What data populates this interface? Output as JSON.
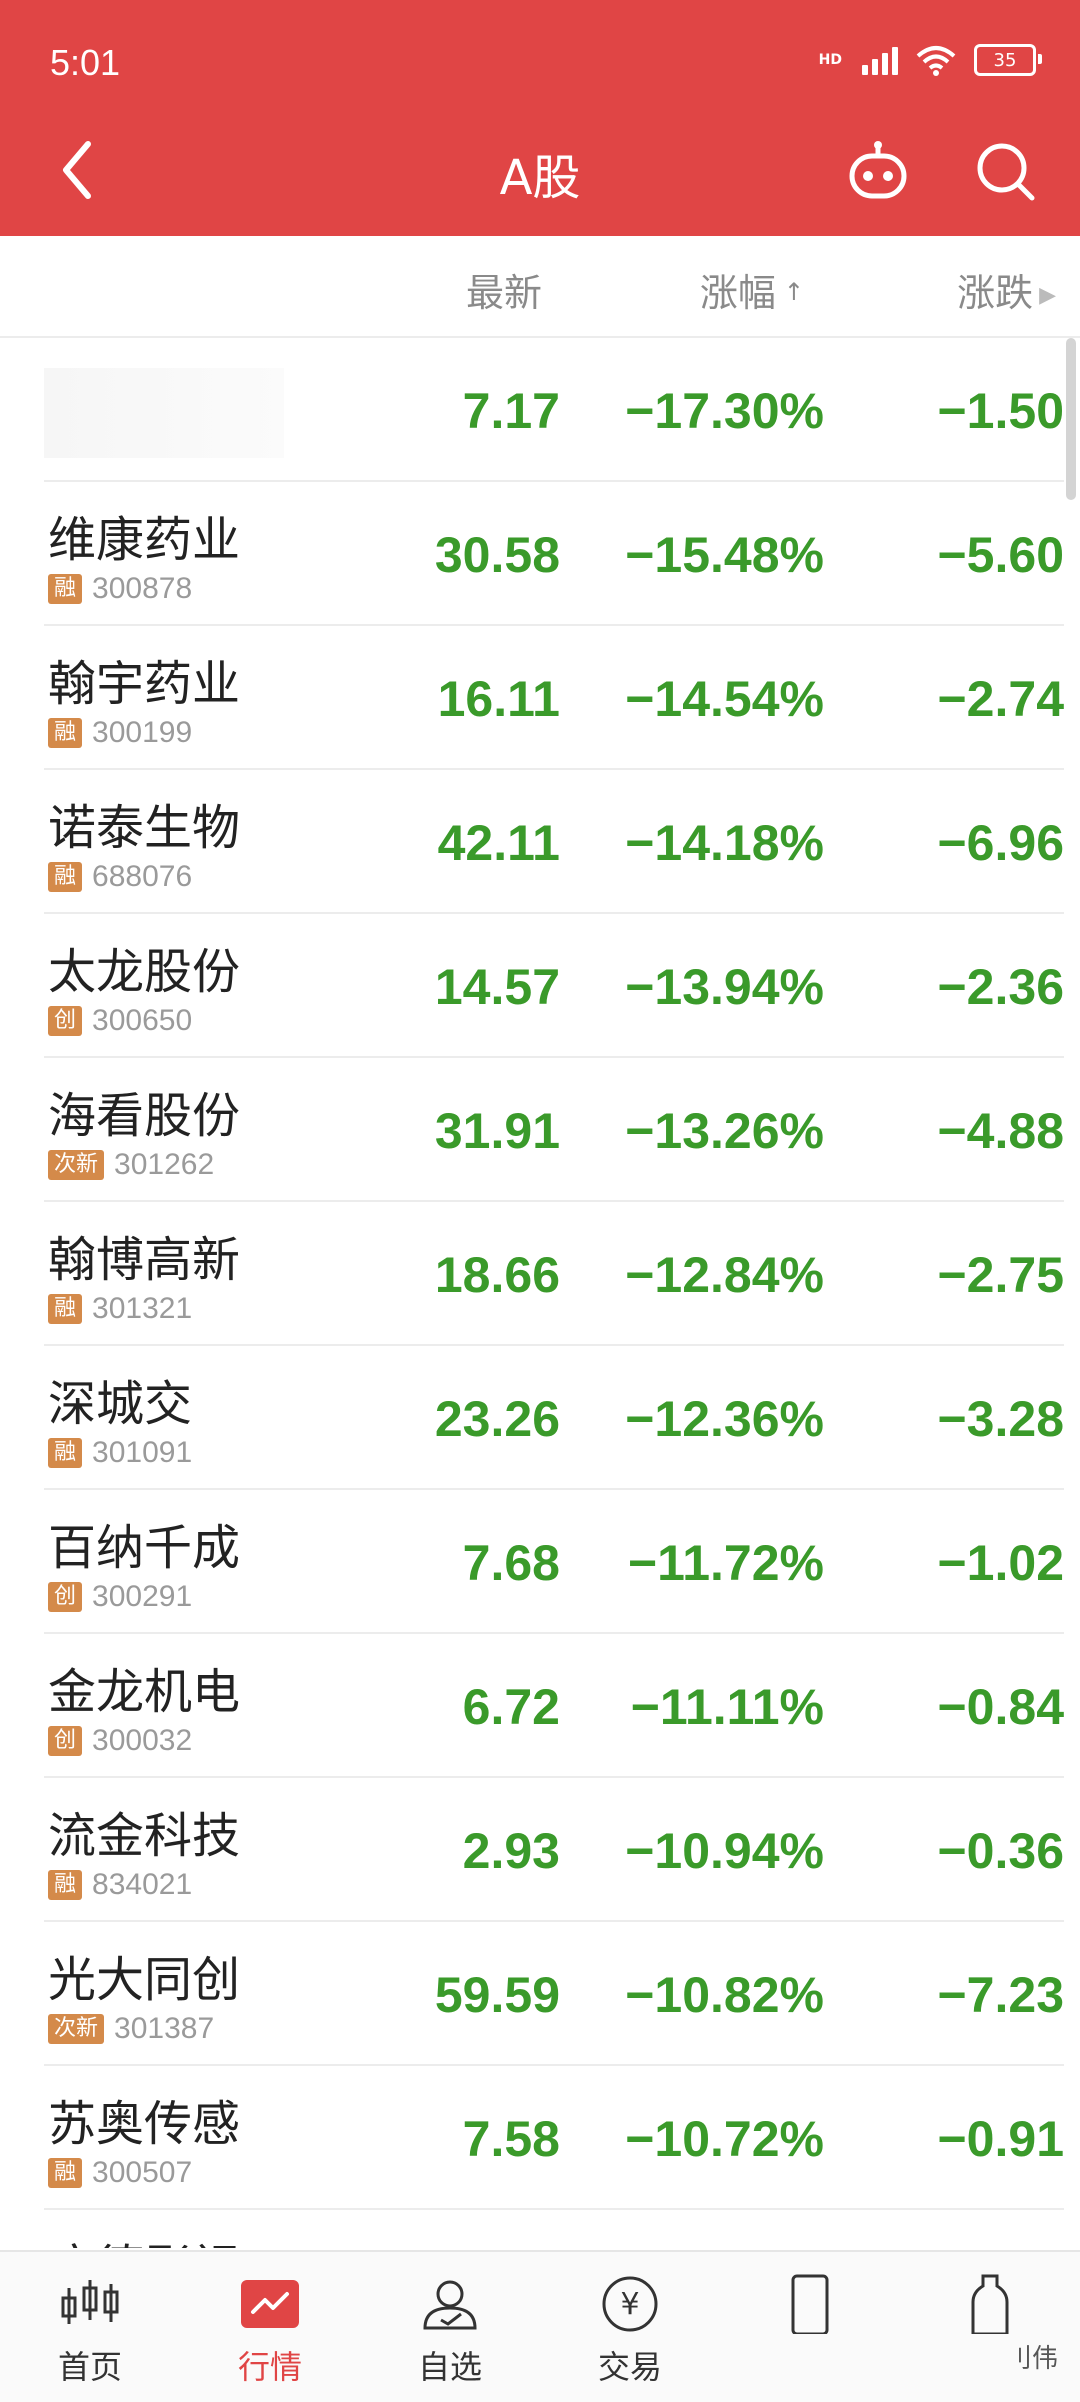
{
  "status": {
    "time": "5:01",
    "network": "HD",
    "battery": "35"
  },
  "header": {
    "title": "A股"
  },
  "columns": {
    "latest": "最新",
    "pct": "涨幅",
    "pct_sort_arrow": "↑",
    "change": "涨跌"
  },
  "rows": [
    {
      "name": "",
      "tag": "",
      "code": "",
      "latest": "7.17",
      "pct": "−17.30%",
      "change": "−1.50"
    },
    {
      "name": "维康药业",
      "tag": "融",
      "code": "300878",
      "latest": "30.58",
      "pct": "−15.48%",
      "change": "−5.60"
    },
    {
      "name": "翰宇药业",
      "tag": "融",
      "code": "300199",
      "latest": "16.11",
      "pct": "−14.54%",
      "change": "−2.74"
    },
    {
      "name": "诺泰生物",
      "tag": "融",
      "code": "688076",
      "latest": "42.11",
      "pct": "−14.18%",
      "change": "−6.96"
    },
    {
      "name": "太龙股份",
      "tag": "创",
      "code": "300650",
      "latest": "14.57",
      "pct": "−13.94%",
      "change": "−2.36"
    },
    {
      "name": "海看股份",
      "tag": "次新",
      "code": "301262",
      "latest": "31.91",
      "pct": "−13.26%",
      "change": "−4.88"
    },
    {
      "name": "翰博高新",
      "tag": "融",
      "code": "301321",
      "latest": "18.66",
      "pct": "−12.84%",
      "change": "−2.75"
    },
    {
      "name": "深城交",
      "tag": "融",
      "code": "301091",
      "latest": "23.26",
      "pct": "−12.36%",
      "change": "−3.28"
    },
    {
      "name": "百纳千成",
      "tag": "创",
      "code": "300291",
      "latest": "7.68",
      "pct": "−11.72%",
      "change": "−1.02"
    },
    {
      "name": "金龙机电",
      "tag": "创",
      "code": "300032",
      "latest": "6.72",
      "pct": "−11.11%",
      "change": "−0.84"
    },
    {
      "name": "流金科技",
      "tag": "融",
      "code": "834021",
      "latest": "2.93",
      "pct": "−10.94%",
      "change": "−0.36"
    },
    {
      "name": "光大同创",
      "tag": "次新",
      "code": "301387",
      "latest": "59.59",
      "pct": "−10.82%",
      "change": "−7.23"
    },
    {
      "name": "苏奥传感",
      "tag": "融",
      "code": "300507",
      "latest": "7.58",
      "pct": "−10.72%",
      "change": "−0.91"
    },
    {
      "name": "唐德影视",
      "tag": "",
      "code": "",
      "latest": "",
      "pct": "",
      "change": ""
    }
  ],
  "tabs": [
    {
      "label": "首页",
      "icon": "candlestick-icon"
    },
    {
      "label": "行情",
      "icon": "market-chart-icon"
    },
    {
      "label": "自选",
      "icon": "person-favorite-icon"
    },
    {
      "label": "交易",
      "icon": "yuan-icon"
    },
    {
      "label": "",
      "icon": "phone-icon"
    },
    {
      "label": "",
      "icon": "bottle-icon"
    }
  ],
  "corner": "刂伟",
  "colors": {
    "brand": "#e04545",
    "down": "#3a9a2a",
    "tag": "#d48a4a"
  }
}
